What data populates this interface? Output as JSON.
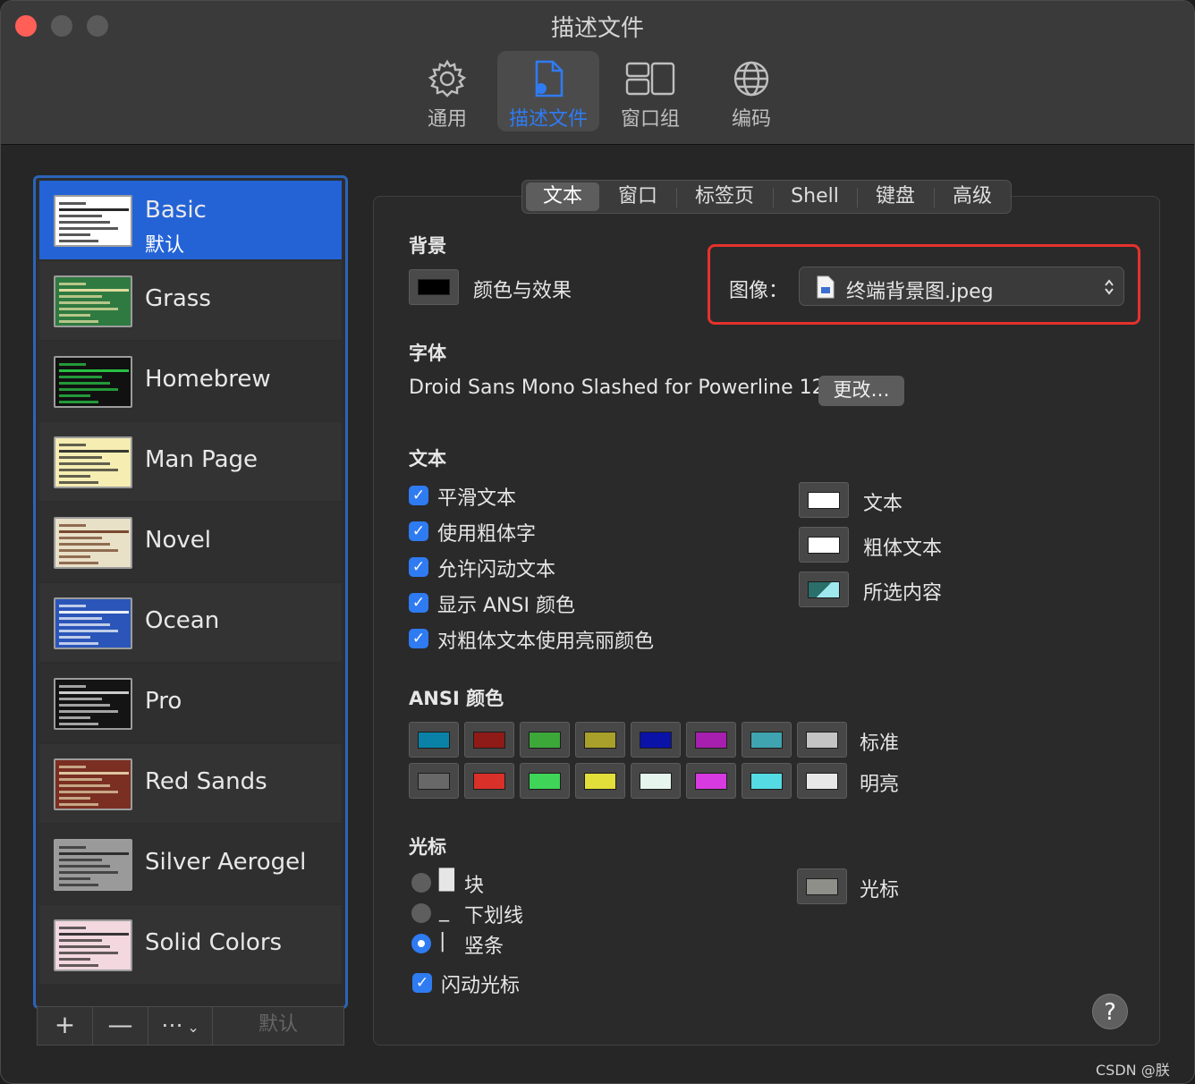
{
  "window": {
    "title": "描述文件"
  },
  "toolbar": [
    {
      "label": "通用",
      "icon": "gear-icon"
    },
    {
      "label": "描述文件",
      "icon": "profile-doc-icon",
      "active": true
    },
    {
      "label": "窗口组",
      "icon": "window-groups-icon"
    },
    {
      "label": "编码",
      "icon": "globe-icon"
    }
  ],
  "profiles": [
    {
      "name": "Basic",
      "sub": "默认",
      "selected": true,
      "thumb_bg": "#ffffff",
      "thumb_fg": "#111111"
    },
    {
      "name": "Grass",
      "thumb_bg": "#2f7a41",
      "thumb_fg": "#f1e7a8"
    },
    {
      "name": "Homebrew",
      "thumb_bg": "#111111",
      "thumb_fg": "#2bd34a"
    },
    {
      "name": "Man Page",
      "thumb_bg": "#f5edb2",
      "thumb_fg": "#222222"
    },
    {
      "name": "Novel",
      "thumb_bg": "#e9e0c8",
      "thumb_fg": "#6a3a1e"
    },
    {
      "name": "Ocean",
      "thumb_bg": "#2b55b8",
      "thumb_fg": "#ffffff"
    },
    {
      "name": "Pro",
      "thumb_bg": "#141414",
      "thumb_fg": "#e0e0e0"
    },
    {
      "name": "Red Sands",
      "thumb_bg": "#7a2f22",
      "thumb_fg": "#e8d8b0"
    },
    {
      "name": "Silver Aerogel",
      "thumb_bg": "#9a9a9a",
      "thumb_fg": "#222222"
    },
    {
      "name": "Solid Colors",
      "thumb_bg": "#f3d8e0",
      "thumb_fg": "#222222"
    }
  ],
  "sidebar_buttons": {
    "add": "+",
    "remove": "—",
    "more": "⋯",
    "default": "默认"
  },
  "tabs": [
    "文本",
    "窗口",
    "标签页",
    "Shell",
    "键盘",
    "高级"
  ],
  "background": {
    "heading": "背景",
    "color_label": "颜色与效果",
    "color": "#000000",
    "image_label": "图像：",
    "image_value": "终端背景图.jpeg"
  },
  "font": {
    "heading": "字体",
    "value": "Droid Sans Mono Slashed for Powerline 12",
    "change_button": "更改…"
  },
  "text": {
    "heading": "文本",
    "checkboxes": [
      "平滑文本",
      "使用粗体字",
      "允许闪动文本",
      "显示 ANSI 颜色",
      "对粗体文本使用亮丽颜色"
    ],
    "colors": [
      {
        "label": "文本",
        "color": "#ffffff"
      },
      {
        "label": "粗体文本",
        "color": "#ffffff"
      },
      {
        "label": "所选内容",
        "color": "#9fe8ee"
      }
    ]
  },
  "ansi": {
    "heading": "ANSI 颜色",
    "normal_label": "标准",
    "bright_label": "明亮",
    "normal": [
      "#0a82a8",
      "#8e1b17",
      "#3da83a",
      "#a8a02a",
      "#0b12a8",
      "#a61fae",
      "#3fa4b0",
      "#c4c4c4"
    ],
    "bright": [
      "#686868",
      "#d9302a",
      "#3fd558",
      "#e2de3a",
      "#e6f5ee",
      "#d63ae0",
      "#55dbe3",
      "#e8e8e8"
    ]
  },
  "cursor": {
    "heading": "光标",
    "options": [
      {
        "glyph": "█",
        "label": "块"
      },
      {
        "glyph": "_",
        "label": "下划线"
      },
      {
        "glyph": "|",
        "label": "竖条",
        "selected": true
      }
    ],
    "blink_label": "闪动光标",
    "color_label": "光标",
    "color": "#8d8f88"
  },
  "help": "?",
  "watermark": "CSDN @朕"
}
